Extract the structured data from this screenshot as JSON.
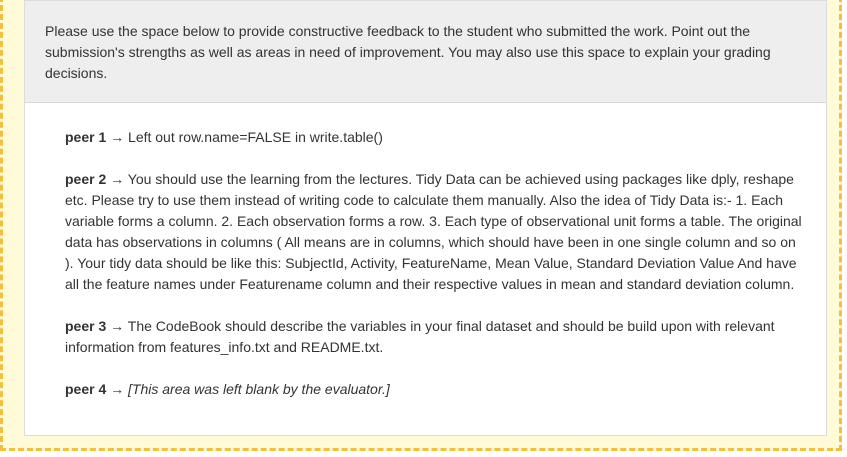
{
  "instructions": "Please use the space below to provide constructive feedback to the student who submitted the work. Point out the submission's strengths as well as areas in need of improvement. You may also use this space to explain your grading decisions.",
  "arrow": "→",
  "feedback": [
    {
      "peer": "peer 1",
      "text": "Left out row.name=FALSE in write.table()"
    },
    {
      "peer": "peer 2",
      "text": "You should use the learning from the lectures. Tidy Data can be achieved using packages like dply, reshape etc. Please try to use them instead of writing code to calculate them manually. Also the idea of Tidy Data is:- 1. Each variable forms a column. 2. Each observation forms a row. 3. Each type of observational unit forms a table. The original data has observations in columns ( All means are in columns, which should have been in one single column and so on ). Your tidy data should be like this: SubjectId, Activity, FeatureName, Mean Value, Standard Deviation Value And have all the feature names under Featurename column and their respective values in mean and standard deviation column."
    },
    {
      "peer": "peer 3",
      "text": "The CodeBook should describe the variables in your final dataset and should be build upon with relevant information from features_info.txt and README.txt."
    },
    {
      "peer": "peer 4",
      "text": "[This area was left blank by the evaluator.]"
    }
  ]
}
